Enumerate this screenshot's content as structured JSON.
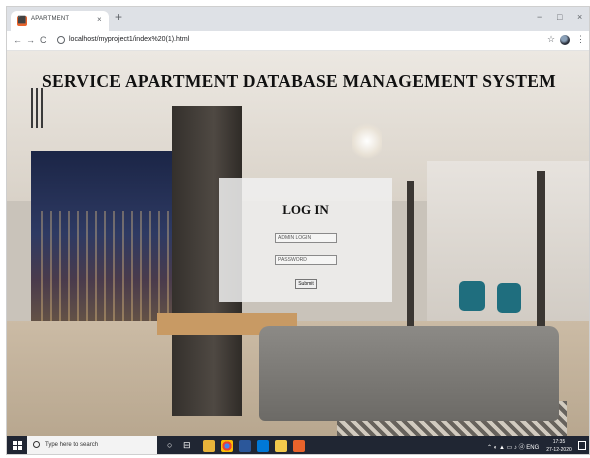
{
  "browser": {
    "tab_title": "APARTMENT",
    "tab_close": "×",
    "new_tab": "+",
    "minimize": "−",
    "maximize": "□",
    "close": "×",
    "back": "←",
    "forward": "→",
    "reload": "C",
    "url": "localhost/myproject1/index%20(1).html",
    "star": "☆",
    "menu": "⋮"
  },
  "page": {
    "heading": "SERVICE APARTMENT DATABASE MANAGEMENT SYSTEM",
    "login": {
      "title": "LOG IN",
      "username_placeholder": "ADMIN LOGIN",
      "password_placeholder": "PASSWORD",
      "submit_label": "Submit"
    }
  },
  "taskbar": {
    "search_placeholder": "Type here to search",
    "tray_text": "ENG",
    "time": "17:35",
    "date": "27-12-2020",
    "pinned_icons": [
      "task-view-icon",
      "file-explorer-icon",
      "chrome-icon",
      "word-icon",
      "photos-icon",
      "sticky-notes-icon",
      "xampp-icon"
    ]
  }
}
